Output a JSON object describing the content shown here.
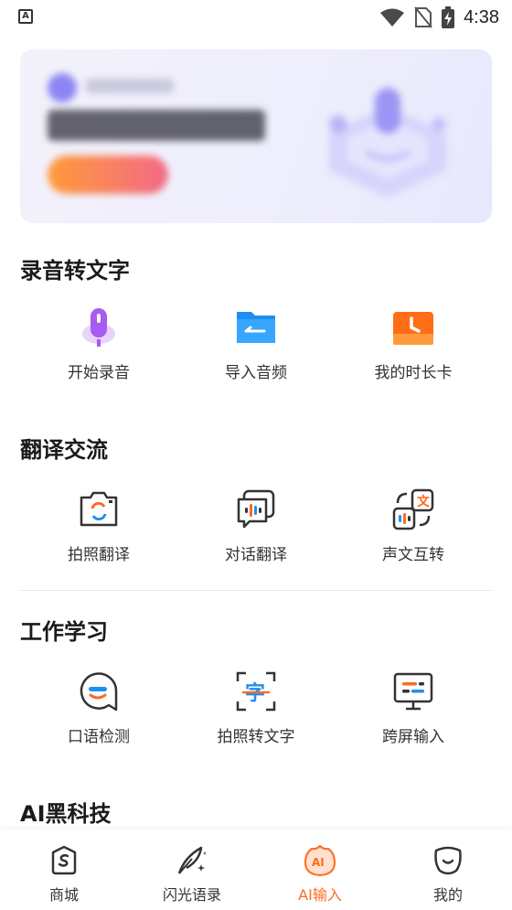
{
  "status_bar": {
    "time": "4:38",
    "app_badge": "A"
  },
  "sections": [
    {
      "title": "录音转文字",
      "items": [
        {
          "label": "开始录音",
          "icon": "microphone-icon"
        },
        {
          "label": "导入音频",
          "icon": "folder-icon"
        },
        {
          "label": "我的时长卡",
          "icon": "clock-card-icon"
        }
      ]
    },
    {
      "title": "翻译交流",
      "items": [
        {
          "label": "拍照翻译",
          "icon": "camera-translate-icon"
        },
        {
          "label": "对话翻译",
          "icon": "dialog-translate-icon"
        },
        {
          "label": "声文互转",
          "icon": "voice-text-convert-icon"
        }
      ]
    },
    {
      "title": "工作学习",
      "items": [
        {
          "label": "口语检测",
          "icon": "speaking-check-icon"
        },
        {
          "label": "拍照转文字",
          "icon": "scan-text-icon"
        },
        {
          "label": "跨屏输入",
          "icon": "monitor-input-icon"
        }
      ]
    },
    {
      "title": "AI黑科技"
    }
  ],
  "bottom_nav": [
    {
      "label": "商城",
      "icon": "shop-icon",
      "active": false
    },
    {
      "label": "闪光语录",
      "icon": "quill-icon",
      "active": false
    },
    {
      "label": "AI输入",
      "icon": "ai-input-icon",
      "active": true
    },
    {
      "label": "我的",
      "icon": "profile-icon",
      "active": false
    }
  ],
  "colors": {
    "accent": "#ff6a1f",
    "mic": "#a65bf2",
    "folder": "#1e8ff2",
    "clock": "#ff6d16"
  }
}
